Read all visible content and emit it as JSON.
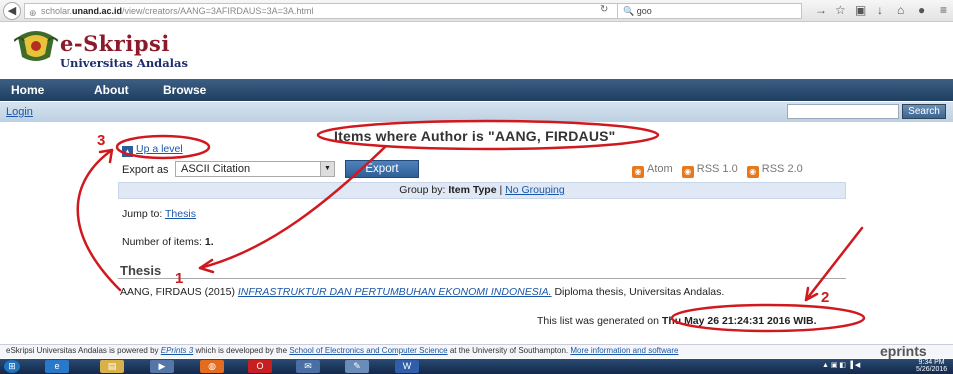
{
  "browser": {
    "url_prefix": "scholar.",
    "url_host": "unand.ac.id",
    "url_path": "/view/creators/AANG=3AFIRDAUS=3A=3A.html",
    "search_value": "goo"
  },
  "site": {
    "logo_title": "e-Skripsi",
    "logo_subtitle": "Universitas Andalas",
    "nav": [
      "Home",
      "About",
      "Browse"
    ],
    "login": "Login",
    "search_button": "Search"
  },
  "content": {
    "title": "Items where Author is \"AANG, FIRDAUS\"",
    "up_level": "Up a level",
    "export_label": "Export as",
    "export_selected": "ASCII Citation",
    "export_button": "Export",
    "feeds": [
      "Atom",
      "RSS 1.0",
      "RSS 2.0"
    ],
    "group_by_label": "Group by:",
    "group_item_type": "Item Type",
    "group_separator": "|",
    "group_none": "No Grouping",
    "jump_to_label": "Jump to:",
    "jump_to_link": "Thesis",
    "num_items_label": "Number of items:",
    "num_items_value": "1.",
    "section_heading": "Thesis",
    "citation_author": "AANG, FIRDAUS (2015)",
    "citation_title": "INFRASTRUKTUR DAN PERTUMBUHAN EKONOMI INDONESIA.",
    "citation_rest": "Diploma thesis, Universitas Andalas.",
    "generated_label": "This list was generated on",
    "generated_value": "Thu May 26 21:24:31 2016 WIB."
  },
  "footer": {
    "text1": "eSkripsi Universitas Andalas is powered by",
    "link1": "EPrints 3",
    "text2": "which is developed by the",
    "link2": "School of Electronics and Computer Science",
    "text3": "at the University of Southampton.",
    "link3": "More information and software",
    "mark": "eprints"
  },
  "annotations": {
    "label1": "1",
    "label2": "2",
    "label3": "3",
    "color": "#d0191f"
  },
  "taskbar": {
    "time": "9:34 PM",
    "date": "5/26/2016"
  }
}
